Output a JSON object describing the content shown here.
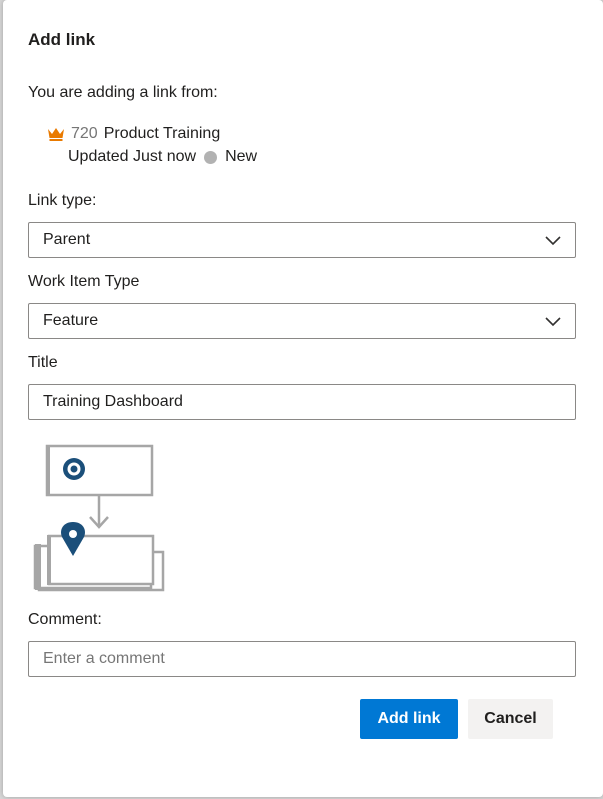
{
  "dialog": {
    "title": "Add link",
    "from_label": "You are adding a link from:"
  },
  "work_item": {
    "icon": "crown-icon",
    "icon_color": "#e97a00",
    "id": "720",
    "title": "Product Training",
    "updated": "Updated Just now",
    "state": "New",
    "state_color": "#b2b2b2"
  },
  "link_type": {
    "label": "Link type:",
    "value": "Parent"
  },
  "work_item_type": {
    "label": "Work Item Type",
    "value": "Feature"
  },
  "title_field": {
    "label": "Title",
    "value": "Training Dashboard"
  },
  "comment": {
    "label": "Comment:",
    "placeholder": "Enter a comment",
    "value": ""
  },
  "buttons": {
    "add_link": "Add link",
    "cancel": "Cancel"
  },
  "colors": {
    "primary": "#0078d4",
    "diagram_accent": "#1b4f7a"
  }
}
